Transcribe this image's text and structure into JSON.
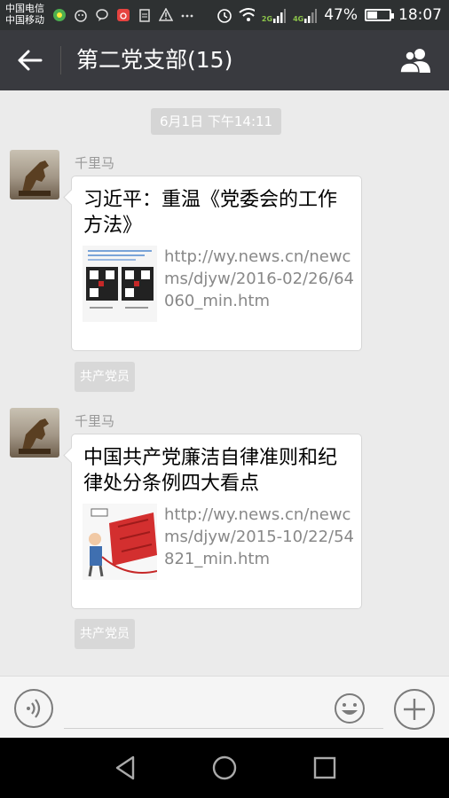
{
  "status_bar": {
    "carrier_line1": "中国电信",
    "carrier_line2": "中国移动",
    "battery_pct": "47%",
    "battery_level": 0.47,
    "time": "18:07",
    "net_tag_1": "2G",
    "net_tag_2": "4G"
  },
  "header": {
    "title": "第二党支部(15)"
  },
  "chat": {
    "timestamp": "6月1日 下午14:11",
    "messages": [
      {
        "sender": "千里马",
        "title": "习近平：重温《党委会的工作方法》",
        "url": "http://wy.news.cn/newcms/djyw/2016-02/26/64060_min.htm",
        "tag": "共产党员"
      },
      {
        "sender": "千里马",
        "title": "中国共产党廉洁自律准则和纪律处分条例四大看点",
        "url": "http://wy.news.cn/newcms/djyw/2015-10/22/54821_min.htm",
        "tag": "共产党员"
      }
    ]
  },
  "input": {
    "placeholder": ""
  }
}
